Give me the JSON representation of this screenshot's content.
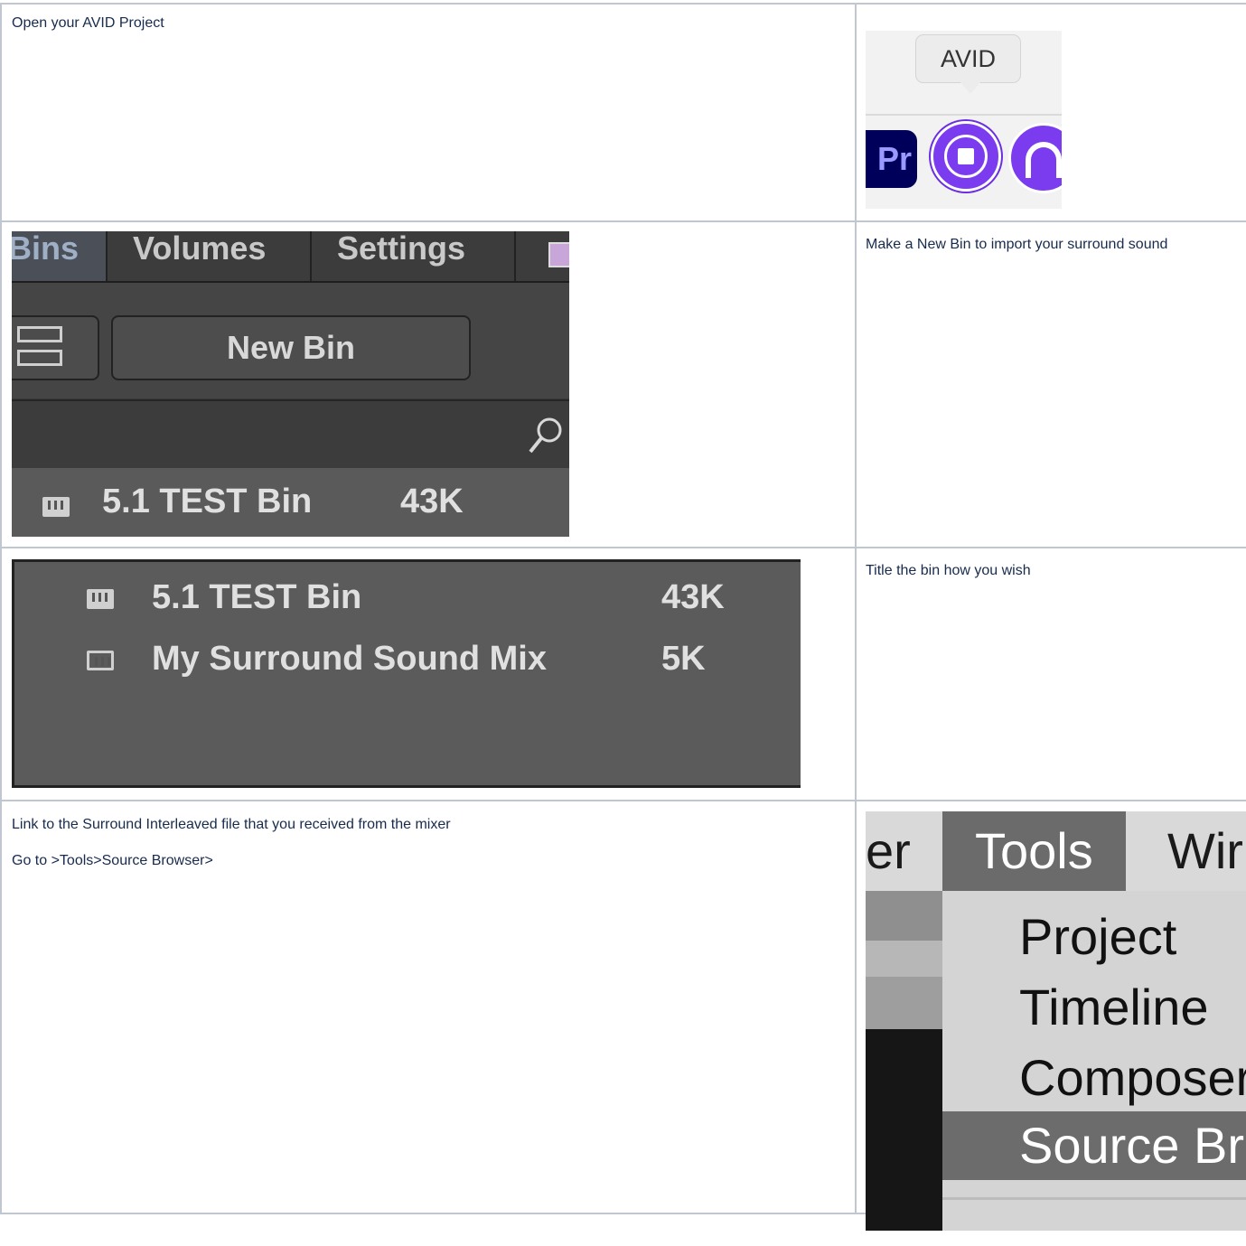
{
  "rows": [
    {
      "text": [
        "Open your AVID Project"
      ]
    },
    {
      "text": [
        "Make a New Bin to import your surround sound"
      ]
    },
    {
      "text": [
        "Title the bin how you wish"
      ]
    },
    {
      "text": [
        "Link to the Surround Interleaved file that you received from the mixer",
        "Go to >Tools>Source Browser>"
      ]
    }
  ],
  "dock_shot": {
    "tooltip": "AVID",
    "icons": [
      "premiere-icon",
      "avid-media-composer-icon",
      "pro-tools-icon"
    ],
    "premiere_label": "Pr"
  },
  "bins_shot": {
    "tabs": [
      "Bins",
      "Volumes",
      "Settings"
    ],
    "new_bin_label": "New Bin",
    "bin_name": "5.1 TEST Bin",
    "bin_size": "43K"
  },
  "binlist_shot": {
    "items": [
      {
        "name": "5.1 TEST Bin",
        "size": "43K"
      },
      {
        "name": "My Surround Sound Mix",
        "size": "5K"
      }
    ]
  },
  "tools_shot": {
    "menubar": [
      "er",
      "Tools",
      "Wir"
    ],
    "menu_items": [
      "Project",
      "Timeline",
      "Composer",
      "Source Br"
    ],
    "selected": "Source Br"
  },
  "colors": {
    "border": "#c1c7d0",
    "avid_purple": "#7b3cf0",
    "menu_highlight": "#6c6c6c"
  }
}
